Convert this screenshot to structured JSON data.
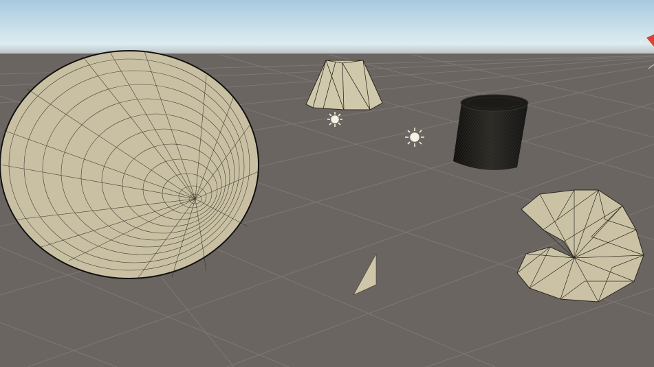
{
  "viewport": {
    "sky_top": "#9ec4dd",
    "sky_horizon": "#dcecef",
    "ground": "#6b6562",
    "grid_color": "#7f7a77",
    "mesh_fill": "#d2c9ac",
    "wire_color": "#1d1c17"
  },
  "gizmo": {
    "x_axis_label": "x",
    "y_axis_color": "#d94232"
  },
  "scene_objects": [
    {
      "name": "sphere",
      "kind": "wireframe-sphere"
    },
    {
      "name": "truncated-cone",
      "kind": "wireframe-frustum"
    },
    {
      "name": "cylinder",
      "kind": "dense-wireframe-cylinder"
    },
    {
      "name": "shell",
      "kind": "wireframe-open-shell"
    },
    {
      "name": "triangle",
      "kind": "single-triangle"
    }
  ],
  "lights": [
    {
      "name": "point-light-1",
      "icon": "sun-icon"
    },
    {
      "name": "point-light-2",
      "icon": "sun-icon"
    }
  ]
}
